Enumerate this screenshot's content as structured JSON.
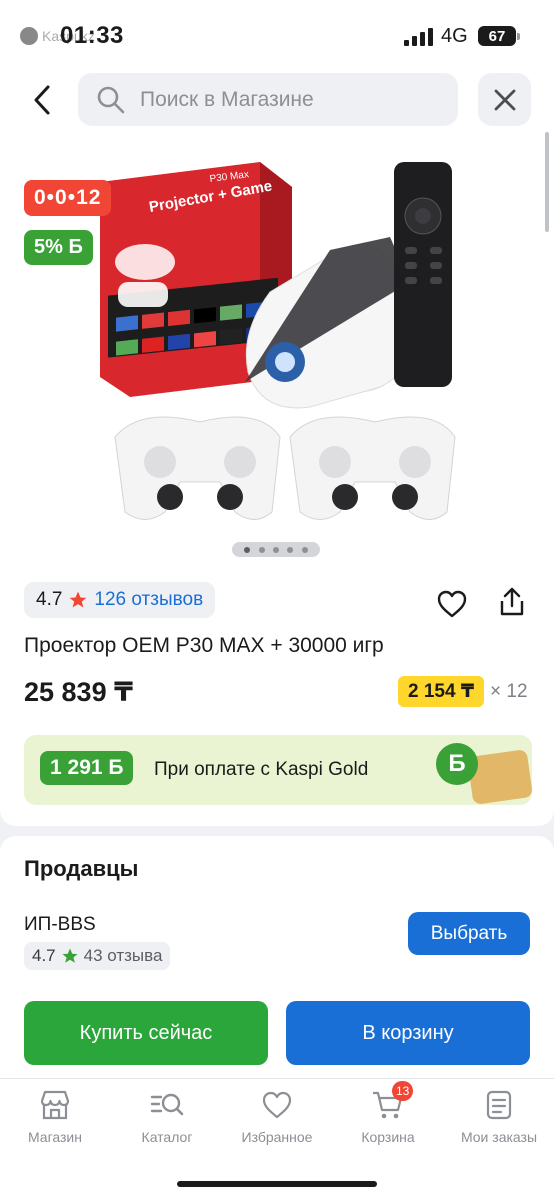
{
  "status_bar": {
    "time": "01:33",
    "back_app": "Kaspi.kz",
    "network": "4G",
    "battery": "67"
  },
  "header": {
    "search_placeholder": "Поиск в Магазине"
  },
  "gallery": {
    "timer_badge": "0•0•12",
    "bonus_badge": "5% Б",
    "image_count": 5,
    "active_image": 1,
    "box_text": "Projector + Game",
    "box_brand": "P30 Max"
  },
  "product": {
    "rating": "4.7",
    "reviews": "126 отзывов",
    "title": "Проектор OEM P30 MAX + 30000 игр",
    "price": "25 839 ₸",
    "installment_amount": "2 154 ₸",
    "installment_months": "× 12"
  },
  "kaspi_gold": {
    "bonus": "1 291 Б",
    "text": "При оплате с Kaspi Gold",
    "coin": "Б"
  },
  "sellers": {
    "heading": "Продавцы",
    "items": [
      {
        "name": "ИП-BBS",
        "rating": "4.7",
        "reviews": "43 отзыва",
        "button": "Выбрать"
      }
    ]
  },
  "actions": {
    "buy_now": "Купить сейчас",
    "to_cart": "В корзину"
  },
  "tabbar": {
    "items": [
      {
        "label": "Магазин",
        "icon": "store-icon"
      },
      {
        "label": "Каталог",
        "icon": "catalog-search-icon"
      },
      {
        "label": "Избранное",
        "icon": "heart-icon"
      },
      {
        "label": "Корзина",
        "icon": "cart-icon",
        "badge": "13"
      },
      {
        "label": "Мои заказы",
        "icon": "orders-icon"
      }
    ]
  },
  "colors": {
    "accent_blue": "#1a6fd6",
    "green": "#2aa63a",
    "red": "#f14635",
    "yellow": "#ffd62c"
  }
}
